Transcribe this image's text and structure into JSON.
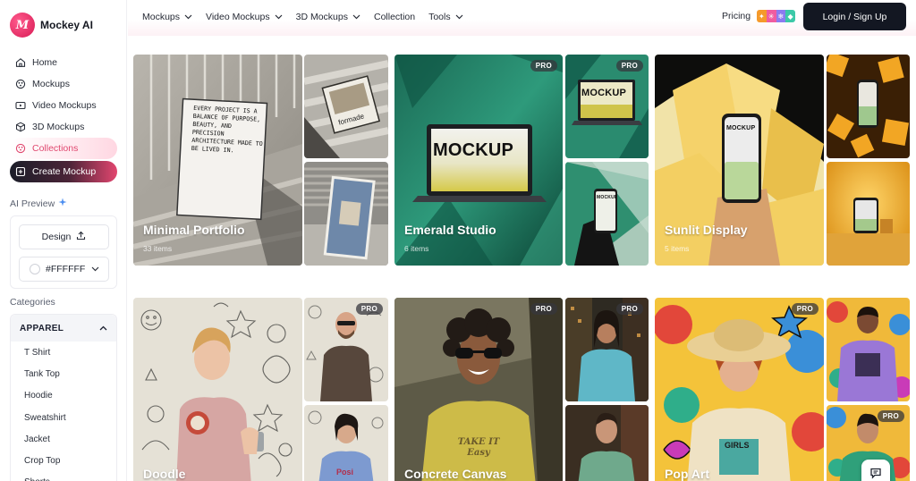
{
  "brand": {
    "logo_text": "M",
    "name": "Mockey AI"
  },
  "sidebar": {
    "nav": [
      {
        "label": "Home",
        "icon": "home-icon"
      },
      {
        "label": "Mockups",
        "icon": "mockups-icon"
      },
      {
        "label": "Video Mockups",
        "icon": "video-icon"
      },
      {
        "label": "3D Mockups",
        "icon": "cube-icon"
      },
      {
        "label": "Collections",
        "icon": "collections-icon"
      },
      {
        "label": "Create Mockup",
        "icon": "create-icon"
      }
    ],
    "ai_preview": {
      "title": "AI Preview",
      "design_label": "Design",
      "color_value": "#FFFFFF"
    },
    "categories": {
      "title": "Categories",
      "group": "APPAREL",
      "items": [
        "T Shirt",
        "Tank Top",
        "Hoodie",
        "Sweatshirt",
        "Jacket",
        "Crop Top",
        "Shorts"
      ]
    }
  },
  "topnav": {
    "menu": [
      {
        "label": "Mockups",
        "has_dropdown": true
      },
      {
        "label": "Video Mockups",
        "has_dropdown": true
      },
      {
        "label": "3D Mockups",
        "has_dropdown": true
      },
      {
        "label": "Collection",
        "has_dropdown": false
      },
      {
        "label": "Tools",
        "has_dropdown": true
      }
    ],
    "pricing_label": "Pricing",
    "login_label": "Login / Sign Up"
  },
  "collections": [
    {
      "title": "Minimal Portfolio",
      "count": "33 items",
      "poster_text": "EVERY PROJECT IS A BALANCE OF PURPOSE, BEAUTY, AND PRECISION ARCHITECTURE MADE TO BE LIVED IN.",
      "book_text": "formade"
    },
    {
      "title": "Emerald Studio",
      "count": "6 items",
      "screen_text": "MOCKUP",
      "badge": "PRO"
    },
    {
      "title": "Sunlit Display",
      "count": "5 items",
      "screen_text": "MOCKUP"
    },
    {
      "title": "Doodle",
      "badge": "PRO"
    },
    {
      "title": "Concrete Canvas",
      "badge": "PRO",
      "shirt_text": "TAKE IT Easy"
    },
    {
      "title": "Pop Art",
      "badge": "PRO",
      "shirt_text": "GIRLS"
    }
  ],
  "colors": {
    "accent": "#e2466f",
    "dark": "#131722"
  }
}
